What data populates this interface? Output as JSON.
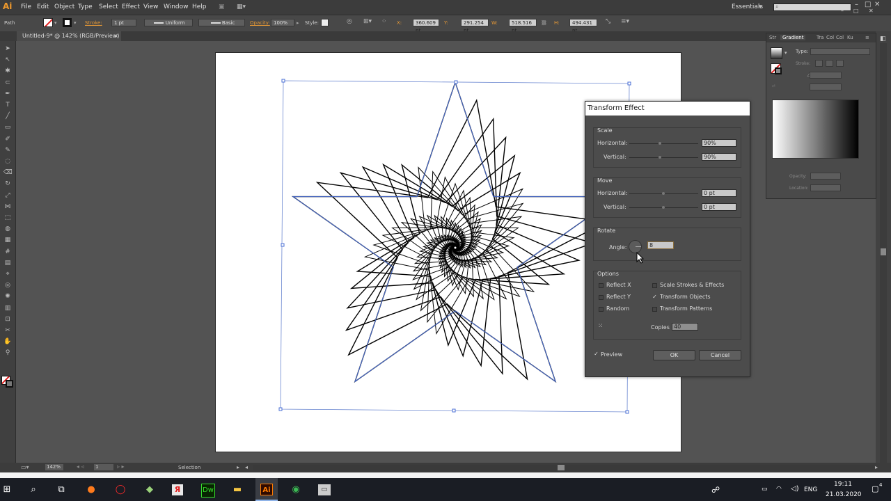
{
  "app": {
    "logo": "Ai"
  },
  "menu": [
    "File",
    "Edit",
    "Object",
    "Type",
    "Select",
    "Effect",
    "View",
    "Window",
    "Help"
  ],
  "workspace": {
    "label": "Essentials",
    "search_placeholder": "",
    "window_buttons": [
      "–",
      "□",
      "✕",
      "–",
      "□",
      "✕"
    ]
  },
  "control_bar": {
    "selection_type": "Path",
    "stroke_label": "Stroke:",
    "stroke_weight": "1 pt",
    "profile": "Uniform",
    "brush": "Basic",
    "opacity_label": "Opacity:",
    "opacity_value": "100%",
    "style_label": "Style:",
    "x_label": "X:",
    "x_value": "360.609 pt",
    "y_label": "Y:",
    "y_value": "291.254 pt",
    "w_label": "W:",
    "w_value": "518.516 pt",
    "h_label": "H:",
    "h_value": "494.431 pt"
  },
  "document_tab": {
    "title": "Untitled-9* @ 142% (RGB/Preview)",
    "close": "×"
  },
  "tool_icons": [
    "selection-tool",
    "direct-selection-tool",
    "magic-wand-tool",
    "lasso-tool",
    "pen-tool",
    "type-tool",
    "line-tool",
    "rectangle-tool",
    "paintbrush-tool",
    "pencil-tool",
    "blob-brush-tool",
    "eraser-tool",
    "rotate-tool",
    "scale-tool",
    "width-tool",
    "free-transform-tool",
    "shape-builder-tool",
    "perspective-grid-tool",
    "mesh-tool",
    "gradient-tool",
    "eyedropper-tool",
    "blend-tool",
    "symbol-sprayer-tool",
    "column-graph-tool",
    "artboard-tool",
    "slice-tool",
    "hand-tool",
    "zoom-tool"
  ],
  "gradient_panel": {
    "tabs": [
      "Str",
      "Gradient",
      "Tra",
      "Col",
      "Col",
      "Ku"
    ],
    "type_label": "Type:",
    "stroke_label": "Stroke:",
    "opacity_label": "Opacity:",
    "location_label": "Location:"
  },
  "dialog": {
    "title": "Transform Effect",
    "scale": {
      "title": "Scale",
      "h_label": "Horizontal:",
      "h_value": "90%",
      "v_label": "Vertical:",
      "v_value": "90%"
    },
    "move": {
      "title": "Move",
      "h_label": "Horizontal:",
      "h_value": "0 pt",
      "v_label": "Vertical:",
      "v_value": "0 pt"
    },
    "rotate": {
      "title": "Rotate",
      "angle_label": "Angle:",
      "angle_value": "8"
    },
    "options": {
      "title": "Options",
      "reflect_x": "Reflect X",
      "reflect_y": "Reflect Y",
      "random": "Random",
      "scale_strokes": "Scale Strokes & Effects",
      "transform_objects": "Transform Objects",
      "transform_patterns": "Transform Patterns",
      "copies_label": "Copies",
      "copies_value": "40",
      "checkmark": "✓"
    },
    "preview_label": "Preview",
    "ok_label": "OK",
    "cancel_label": "Cancel"
  },
  "status_bar": {
    "zoom": "142%",
    "page": "1",
    "tool": "Selection"
  },
  "taskbar": {
    "apps": [
      "start",
      "search",
      "task-view",
      "firefox",
      "opera",
      "whatsapp-editor",
      "yandex",
      "dreamweaver",
      "file-explorer",
      "illustrator",
      "chrome",
      "camstudio"
    ],
    "dw_label": "Dw",
    "ai_label": "Ai",
    "yandex_label": "Я",
    "lang": "ENG",
    "time": "19:11",
    "date": "21.03.2020",
    "notifications": "4"
  },
  "star": {
    "copies": 40,
    "scale": 0.9,
    "angle_deg": 8,
    "outer_radius": 245,
    "inner_ratio": 0.382
  }
}
